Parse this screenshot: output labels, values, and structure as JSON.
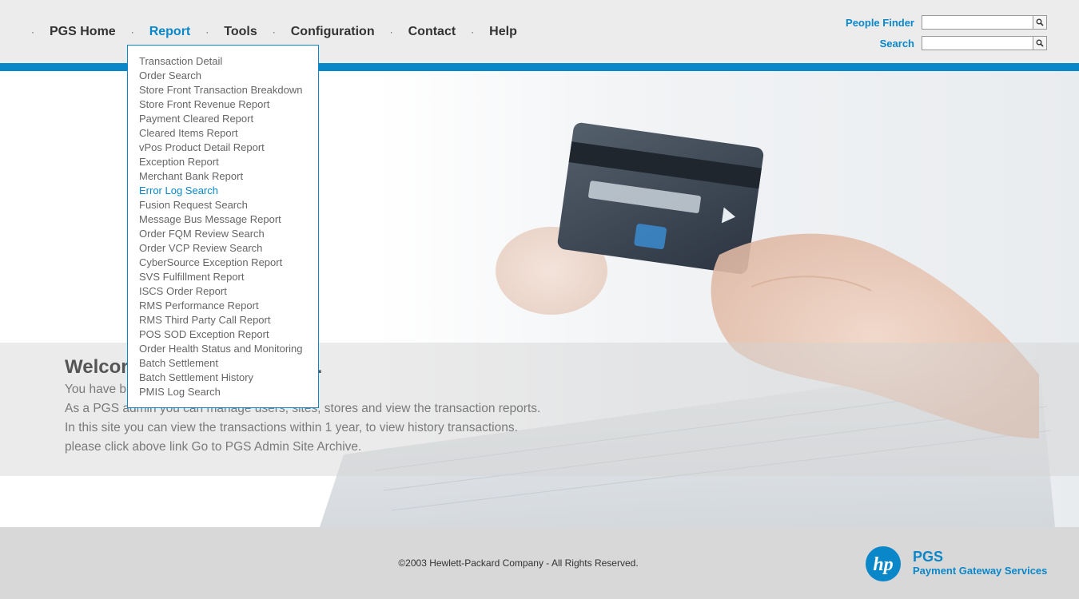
{
  "nav": {
    "items": [
      {
        "label": "PGS Home"
      },
      {
        "label": "Report"
      },
      {
        "label": "Tools"
      },
      {
        "label": "Configuration"
      },
      {
        "label": "Contact"
      },
      {
        "label": "Help"
      }
    ],
    "active": "Report"
  },
  "finder": {
    "people_finder_label": "People Finder",
    "people_finder_value": "",
    "search_label": "Search",
    "search_value": "",
    "button_icon": "search-icon"
  },
  "report_menu": {
    "items": [
      "Transaction Detail",
      "Order Search",
      "Store Front Transaction Breakdown",
      "Store Front Revenue Report",
      "Payment Cleared Report",
      "Cleared Items Report",
      "vPos Product Detail Report",
      "Exception Report",
      "Merchant Bank Report",
      "Error Log Search",
      "Fusion Request Search",
      "Message Bus Message Report",
      "Order FQM Review Search",
      "Order VCP Review Search",
      "CyberSource Exception Report",
      "SVS Fulfillment Report",
      "ISCS Order Report",
      "RMS Performance Report",
      "RMS Third Party Call Report",
      "POS SOD Exception Report",
      "Order Health Status and Monitoring",
      "Batch Settlement",
      "Batch Settlement History",
      "PMIS Log Search"
    ],
    "highlighted": "Error Log Search"
  },
  "welcome": {
    "title": "Welcor",
    "title_tail": ".",
    "lines": [
      "You have b",
      "As a PGS admin you can manage users, sites, stores and view the transaction reports.",
      "In this site you can view the transactions within 1 year, to view history transactions.",
      "please click above link Go to PGS Admin Site Archive."
    ]
  },
  "footer": {
    "copyright": "©2003 Hewlett-Packard Company - All Rights Reserved.",
    "logo_text": "hp",
    "brand_title": "PGS",
    "brand_subtitle": "Payment Gateway Services"
  },
  "colors": {
    "accent": "#0a87c8",
    "header_bg": "#ececec",
    "footer_bg": "#d8d8d8"
  }
}
